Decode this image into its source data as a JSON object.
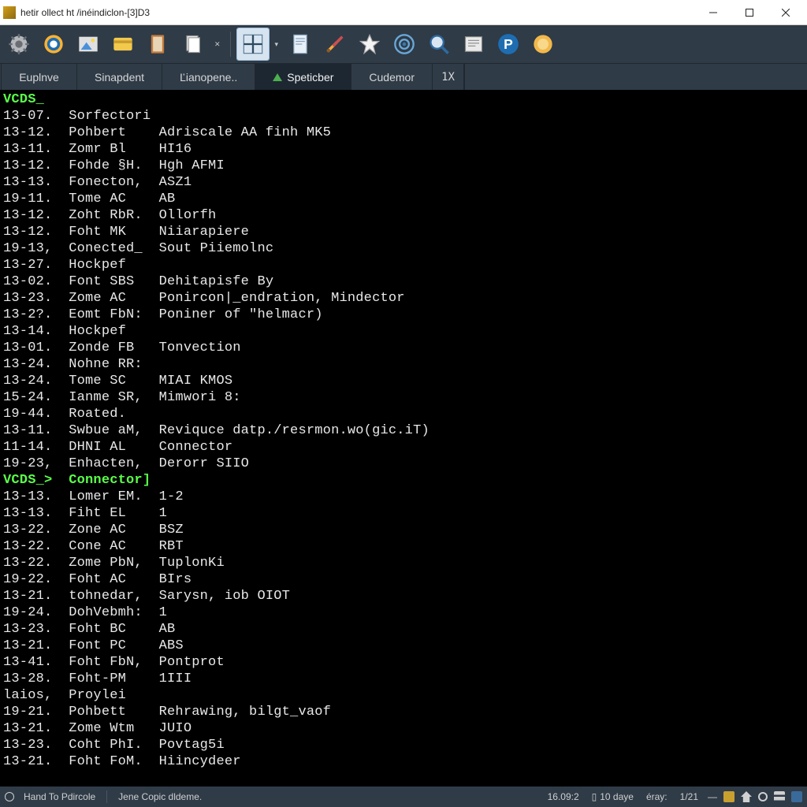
{
  "window": {
    "title": "hetir ollect ht /inéindiclon-[3]D3"
  },
  "toolbar": {
    "icons": [
      "gear",
      "globe",
      "picture",
      "card",
      "notebook",
      "pages",
      "crosshair",
      "document",
      "tools",
      "star",
      "target",
      "zoom",
      "newspaper",
      "parking",
      "coin"
    ]
  },
  "tabs": [
    {
      "label": "Euplnve",
      "active": false,
      "icon": ""
    },
    {
      "label": "Sinapdent",
      "active": false,
      "icon": ""
    },
    {
      "label": "Ľianopene..",
      "active": false,
      "icon": ""
    },
    {
      "label": "Speticber",
      "active": true,
      "icon": "green"
    },
    {
      "label": "Cudemor",
      "active": false,
      "icon": ""
    },
    {
      "label": "1X",
      "active": false,
      "icon": "",
      "narrow": true
    }
  ],
  "term": {
    "prompts": [
      "VCDS_",
      "VCDS_>  Connector]"
    ],
    "sections": [
      [
        {
          "a": "13-07.",
          "b": "Sorfectori",
          "c": ""
        },
        {
          "a": "13-12.",
          "b": "Pohbert",
          "c": "Adriscale AA finh MK5"
        },
        {
          "a": "13-11.",
          "b": "Zomr Bl",
          "c": "HI16"
        },
        {
          "a": "13-12.",
          "b": "Fohde §H.",
          "c": "Hgh AFMI"
        },
        {
          "a": "13-13.",
          "b": "Fonecton,",
          "c": "ASZ1"
        },
        {
          "a": "19-11.",
          "b": "Tome AC",
          "c": "AB"
        },
        {
          "a": "13-12.",
          "b": "Zoht RbR.",
          "c": "Ollorfh"
        },
        {
          "a": "13-12.",
          "b": "Foht MK",
          "c": "Niiarapiere"
        },
        {
          "a": "19-13,",
          "b": "Conected_",
          "c": "Sout Piiemolnc"
        },
        {
          "a": "13-27.",
          "b": "Hockpef",
          "c": ""
        },
        {
          "a": "13-02.",
          "b": "Font SBS",
          "c": "Dehitapisfe By"
        },
        {
          "a": "13-23.",
          "b": "Zome AC",
          "c": "Ponircon|_endration, Mindector"
        },
        {
          "a": "13-2?.",
          "b": "Eomt FbN:",
          "c": "Poniner of \"helmacr)"
        },
        {
          "a": "13-14.",
          "b": "Hockpef",
          "c": ""
        },
        {
          "a": "13-01.",
          "b": "Zonde FB",
          "c": "Tonvection"
        },
        {
          "a": "13-24.",
          "b": "Nohne RR:",
          "c": ""
        },
        {
          "a": "13-24.",
          "b": "Tome SC",
          "c": "MIAI KMOS"
        },
        {
          "a": "15-24.",
          "b": "Ianme SR,",
          "c": "Mimwori 8:"
        },
        {
          "a": "19-44.",
          "b": "Roated.",
          "c": ""
        },
        {
          "a": "13-11.",
          "b": "Swbue aM,",
          "c": "Reviquce datp./resrmon.wo(gic.iT)"
        },
        {
          "a": "11-14.",
          "b": "DHNI AL",
          "c": "Connector"
        },
        {
          "a": "19-23,",
          "b": "Enhacten,",
          "c": "Derorr SIIO"
        }
      ],
      [
        {
          "a": "13-13.",
          "b": "Lomer EM.",
          "c": "1-2"
        },
        {
          "a": "13-13.",
          "b": "Fiht EL",
          "c": "1"
        },
        {
          "a": "13-22.",
          "b": "Zone AC",
          "c": "BSZ"
        },
        {
          "a": "13-22.",
          "b": "Cone AC",
          "c": "RBT"
        },
        {
          "a": "13-22.",
          "b": "Zome PbN,",
          "c": "TuplonKi"
        },
        {
          "a": "19-22.",
          "b": "Foht AC",
          "c": "BIrs"
        },
        {
          "a": "13-21.",
          "b": "tohnedar,",
          "c": "Sarysn, iob OIOT"
        },
        {
          "a": "19-24.",
          "b": "DohVebmh:",
          "c": "1"
        },
        {
          "a": "13-23.",
          "b": "Foht BC",
          "c": "AB"
        },
        {
          "a": "13-21.",
          "b": "Font PC",
          "c": "ABS"
        },
        {
          "a": "13-41.",
          "b": "Foht FbN,",
          "c": "Pontprot"
        },
        {
          "a": "13-28.",
          "b": "Foht-PM",
          "c": "1III"
        },
        {
          "a": "laios,",
          "b": "Proylei",
          "c": ""
        },
        {
          "a": "19-21.",
          "b": "Pohbett",
          "c": "Rehrawing, bilgt_vaof"
        },
        {
          "a": "13-21.",
          "b": "Zome Wtm",
          "c": "JUIO"
        },
        {
          "a": "13-23.",
          "b": "Coht PhI.",
          "c": "Povtag5i"
        },
        {
          "a": "13-21.",
          "b": "Foht FoM.",
          "c": "Hiincydeer"
        }
      ]
    ]
  },
  "status": {
    "left1": "Hand To Pdircole",
    "left2": "Jene Copic dldeme.",
    "num1": "16.09:2",
    "num2": "10 daye",
    "num3": "éray:",
    "num4": "1/21"
  },
  "colors": {
    "toolbar_bg": "#2f3b47",
    "terminal_bg": "#000000",
    "prompt": "#5aff4a"
  }
}
